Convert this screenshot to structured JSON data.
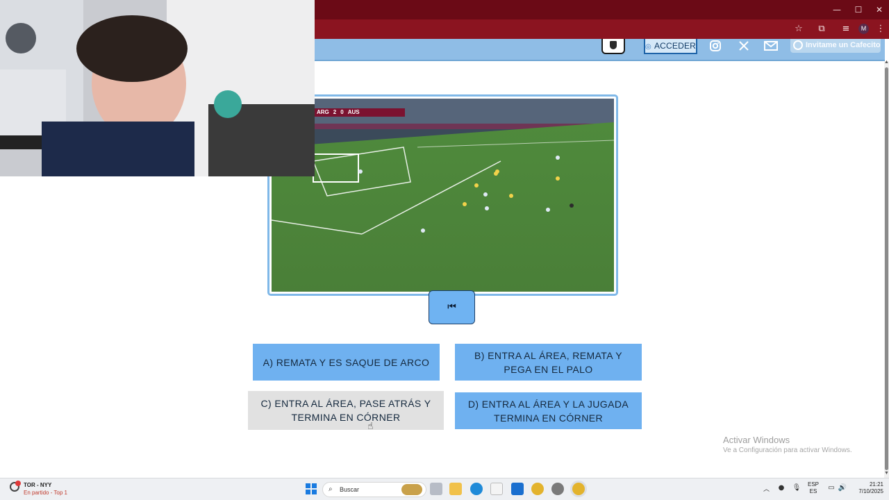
{
  "browser": {
    "window_controls": [
      "—",
      "☐",
      "✕"
    ],
    "profile_initial": "M"
  },
  "header": {
    "acceder_label": "ACCEDER",
    "cafecito_label": "Invitame un Cafecito"
  },
  "video": {
    "score": {
      "team_home": "ARG",
      "home_goals": "2",
      "away_goals": "0",
      "team_away": "AUS"
    },
    "restart_symbol": "⏮"
  },
  "answers": [
    {
      "label": "A) REMATA Y ES SAQUE DE ARCO",
      "state": "default"
    },
    {
      "label": "B) ENTRA AL ÁREA, REMATA Y PEGA EN EL PALO",
      "state": "default"
    },
    {
      "label": "C) ENTRA AL ÁREA, PASE ATRÁS Y TERMINA EN CÓRNER",
      "state": "hover"
    },
    {
      "label": "D) ENTRA AL ÁREA Y LA JUGADA TERMINA EN CÓRNER",
      "state": "default"
    }
  ],
  "watermark": {
    "title": "Activar Windows",
    "subtitle": "Ve a Configuración para activar Windows."
  },
  "taskbar": {
    "news_title": "TOR - NYY",
    "news_sub": "En partido - Top 1",
    "search_label": "Buscar",
    "lang_top": "ESP",
    "lang_bottom": "ES",
    "time": "21:21",
    "date": "7/10/2025"
  },
  "colors": {
    "answer_blue": "#6fb1f0",
    "answer_hover": "#e1e1e1",
    "header_blue": "#8fbde6",
    "browser_red": "#8b1420"
  }
}
